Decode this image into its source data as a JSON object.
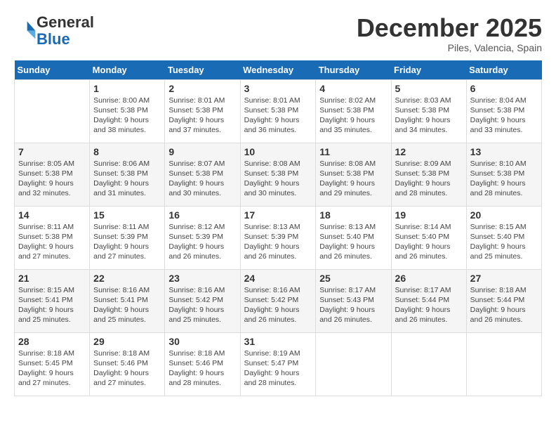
{
  "header": {
    "logo_line1": "General",
    "logo_line2": "Blue",
    "month": "December 2025",
    "location": "Piles, Valencia, Spain"
  },
  "weekdays": [
    "Sunday",
    "Monday",
    "Tuesday",
    "Wednesday",
    "Thursday",
    "Friday",
    "Saturday"
  ],
  "weeks": [
    [
      {
        "day": "",
        "info": ""
      },
      {
        "day": "1",
        "info": "Sunrise: 8:00 AM\nSunset: 5:38 PM\nDaylight: 9 hours\nand 38 minutes."
      },
      {
        "day": "2",
        "info": "Sunrise: 8:01 AM\nSunset: 5:38 PM\nDaylight: 9 hours\nand 37 minutes."
      },
      {
        "day": "3",
        "info": "Sunrise: 8:01 AM\nSunset: 5:38 PM\nDaylight: 9 hours\nand 36 minutes."
      },
      {
        "day": "4",
        "info": "Sunrise: 8:02 AM\nSunset: 5:38 PM\nDaylight: 9 hours\nand 35 minutes."
      },
      {
        "day": "5",
        "info": "Sunrise: 8:03 AM\nSunset: 5:38 PM\nDaylight: 9 hours\nand 34 minutes."
      },
      {
        "day": "6",
        "info": "Sunrise: 8:04 AM\nSunset: 5:38 PM\nDaylight: 9 hours\nand 33 minutes."
      }
    ],
    [
      {
        "day": "7",
        "info": "Sunrise: 8:05 AM\nSunset: 5:38 PM\nDaylight: 9 hours\nand 32 minutes."
      },
      {
        "day": "8",
        "info": "Sunrise: 8:06 AM\nSunset: 5:38 PM\nDaylight: 9 hours\nand 31 minutes."
      },
      {
        "day": "9",
        "info": "Sunrise: 8:07 AM\nSunset: 5:38 PM\nDaylight: 9 hours\nand 30 minutes."
      },
      {
        "day": "10",
        "info": "Sunrise: 8:08 AM\nSunset: 5:38 PM\nDaylight: 9 hours\nand 30 minutes."
      },
      {
        "day": "11",
        "info": "Sunrise: 8:08 AM\nSunset: 5:38 PM\nDaylight: 9 hours\nand 29 minutes."
      },
      {
        "day": "12",
        "info": "Sunrise: 8:09 AM\nSunset: 5:38 PM\nDaylight: 9 hours\nand 28 minutes."
      },
      {
        "day": "13",
        "info": "Sunrise: 8:10 AM\nSunset: 5:38 PM\nDaylight: 9 hours\nand 28 minutes."
      }
    ],
    [
      {
        "day": "14",
        "info": "Sunrise: 8:11 AM\nSunset: 5:38 PM\nDaylight: 9 hours\nand 27 minutes."
      },
      {
        "day": "15",
        "info": "Sunrise: 8:11 AM\nSunset: 5:39 PM\nDaylight: 9 hours\nand 27 minutes."
      },
      {
        "day": "16",
        "info": "Sunrise: 8:12 AM\nSunset: 5:39 PM\nDaylight: 9 hours\nand 26 minutes."
      },
      {
        "day": "17",
        "info": "Sunrise: 8:13 AM\nSunset: 5:39 PM\nDaylight: 9 hours\nand 26 minutes."
      },
      {
        "day": "18",
        "info": "Sunrise: 8:13 AM\nSunset: 5:40 PM\nDaylight: 9 hours\nand 26 minutes."
      },
      {
        "day": "19",
        "info": "Sunrise: 8:14 AM\nSunset: 5:40 PM\nDaylight: 9 hours\nand 26 minutes."
      },
      {
        "day": "20",
        "info": "Sunrise: 8:15 AM\nSunset: 5:40 PM\nDaylight: 9 hours\nand 25 minutes."
      }
    ],
    [
      {
        "day": "21",
        "info": "Sunrise: 8:15 AM\nSunset: 5:41 PM\nDaylight: 9 hours\nand 25 minutes."
      },
      {
        "day": "22",
        "info": "Sunrise: 8:16 AM\nSunset: 5:41 PM\nDaylight: 9 hours\nand 25 minutes."
      },
      {
        "day": "23",
        "info": "Sunrise: 8:16 AM\nSunset: 5:42 PM\nDaylight: 9 hours\nand 25 minutes."
      },
      {
        "day": "24",
        "info": "Sunrise: 8:16 AM\nSunset: 5:42 PM\nDaylight: 9 hours\nand 26 minutes."
      },
      {
        "day": "25",
        "info": "Sunrise: 8:17 AM\nSunset: 5:43 PM\nDaylight: 9 hours\nand 26 minutes."
      },
      {
        "day": "26",
        "info": "Sunrise: 8:17 AM\nSunset: 5:44 PM\nDaylight: 9 hours\nand 26 minutes."
      },
      {
        "day": "27",
        "info": "Sunrise: 8:18 AM\nSunset: 5:44 PM\nDaylight: 9 hours\nand 26 minutes."
      }
    ],
    [
      {
        "day": "28",
        "info": "Sunrise: 8:18 AM\nSunset: 5:45 PM\nDaylight: 9 hours\nand 27 minutes."
      },
      {
        "day": "29",
        "info": "Sunrise: 8:18 AM\nSunset: 5:46 PM\nDaylight: 9 hours\nand 27 minutes."
      },
      {
        "day": "30",
        "info": "Sunrise: 8:18 AM\nSunset: 5:46 PM\nDaylight: 9 hours\nand 28 minutes."
      },
      {
        "day": "31",
        "info": "Sunrise: 8:19 AM\nSunset: 5:47 PM\nDaylight: 9 hours\nand 28 minutes."
      },
      {
        "day": "",
        "info": ""
      },
      {
        "day": "",
        "info": ""
      },
      {
        "day": "",
        "info": ""
      }
    ]
  ]
}
